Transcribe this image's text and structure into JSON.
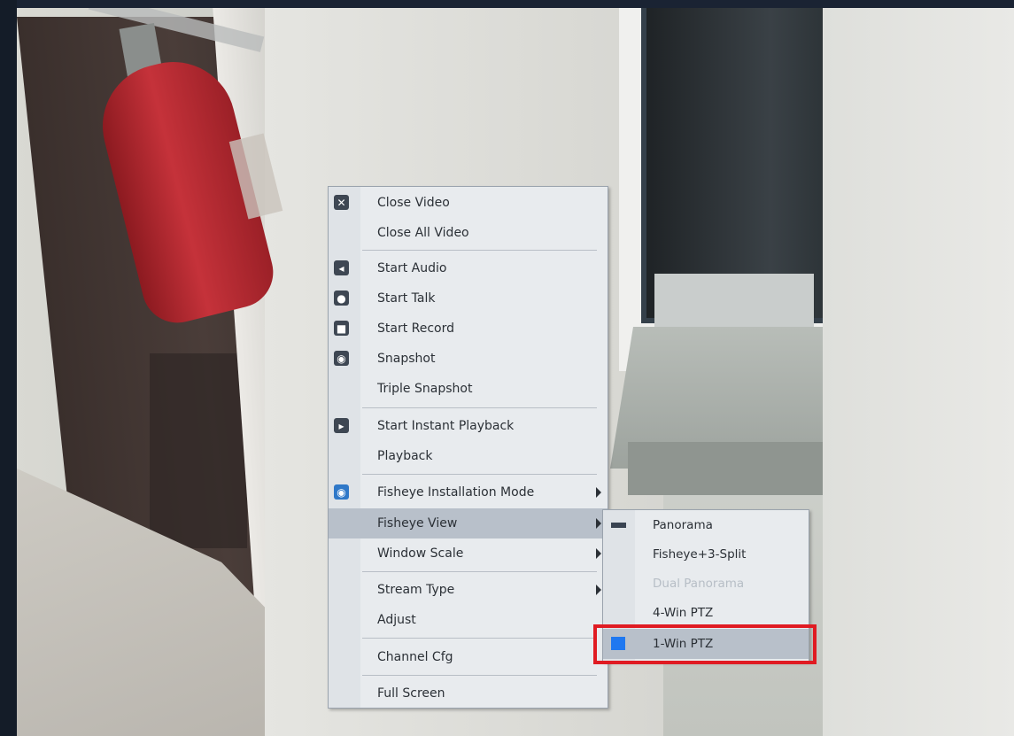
{
  "main_menu": {
    "items": [
      {
        "label": "Close Video",
        "icon": "close-icon"
      },
      {
        "label": "Close All Video",
        "icon": ""
      },
      {
        "label": "Start Audio",
        "icon": "speaker-icon"
      },
      {
        "label": "Start Talk",
        "icon": "microphone-icon"
      },
      {
        "label": "Start Record",
        "icon": "record-icon"
      },
      {
        "label": "Snapshot",
        "icon": "camera-icon"
      },
      {
        "label": "Triple Snapshot",
        "icon": ""
      },
      {
        "label": "Start Instant Playback",
        "icon": "instant-playback-icon"
      },
      {
        "label": "Playback",
        "icon": ""
      },
      {
        "label": "Fisheye Installation Mode",
        "icon": "fisheye-eye-icon",
        "submenu": true
      },
      {
        "label": "Fisheye View",
        "icon": "",
        "submenu": true,
        "highlighted": true
      },
      {
        "label": "Window Scale",
        "icon": "",
        "submenu": true
      },
      {
        "label": "Stream Type",
        "icon": "",
        "submenu": true
      },
      {
        "label": "Adjust",
        "icon": ""
      },
      {
        "label": "Channel Cfg",
        "icon": ""
      },
      {
        "label": "Full Screen",
        "icon": ""
      }
    ]
  },
  "sub_menu": {
    "items": [
      {
        "label": "Panorama",
        "icon": "panorama-bar-icon",
        "enabled": true
      },
      {
        "label": "Fisheye+3-Split",
        "icon": "fisheye-3-split-icon",
        "enabled": true
      },
      {
        "label": "Dual Panorama",
        "icon": "dual-panorama-icon",
        "enabled": false
      },
      {
        "label": "4-Win PTZ",
        "icon": "four-win-grid-icon",
        "enabled": true
      },
      {
        "label": "1-Win PTZ",
        "icon": "one-win-square-icon",
        "enabled": true,
        "highlighted": true
      }
    ]
  },
  "colors": {
    "highlight": "#b8c0ca",
    "annotation_box": "#e01b22",
    "one_win_icon": "#1f78f0"
  }
}
